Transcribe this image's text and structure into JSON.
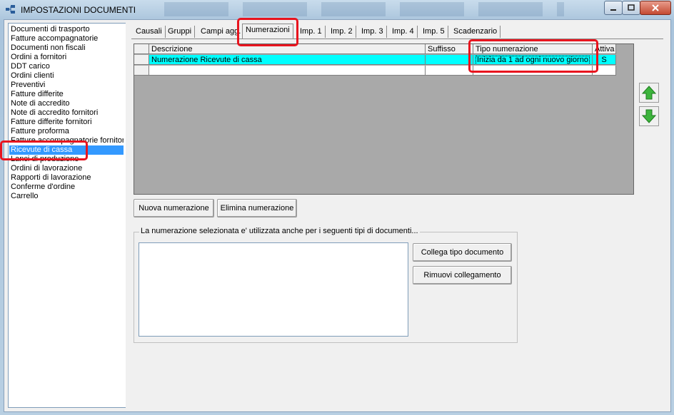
{
  "window": {
    "title": "IMPOSTAZIONI DOCUMENTI",
    "controls": {
      "minimize": "minimize-icon",
      "maximize": "maximize-icon",
      "close": "close-icon"
    }
  },
  "doc_types": [
    "Documenti di trasporto",
    "Fatture accompagnatorie",
    "Documenti non fiscali",
    "Ordini a fornitori",
    "DDT carico",
    "Ordini clienti",
    "Preventivi",
    "Fatture differite",
    "Note di accredito",
    "Note di accredito fornitori",
    "Fatture differite fornitori",
    "Fatture proforma",
    "Fatture accompagnatorie fornitori",
    "Ricevute di cassa",
    "Lanci di produzione",
    "Ordini di lavorazione",
    "Rapporti di lavorazione",
    "Conferme d'ordine",
    "Carrello"
  ],
  "selected_doc_type": "Ricevute di cassa",
  "tabs": [
    "Causali",
    "Gruppi",
    "Campi agg.",
    "Numerazioni",
    "Imp. 1",
    "Imp. 2",
    "Imp. 3",
    "Imp. 4",
    "Imp. 5",
    "Scadenzario"
  ],
  "active_tab": "Numerazioni",
  "grid": {
    "columns": [
      "Descrizione",
      "Suffisso",
      "Tipo numerazione",
      "Attiva"
    ],
    "rows": [
      {
        "descrizione": "Numerazione Ricevute di cassa",
        "suffisso": "",
        "tipo": "Inizia da 1 ad ogni nuovo giorno",
        "attiva": "S"
      }
    ]
  },
  "buttons": {
    "nuova": "Nuova numerazione",
    "elimina": "Elimina numerazione",
    "collega": "Collega tipo documento",
    "rimuovi": "Rimuovi collegamento"
  },
  "group": {
    "label": "La numerazione selezionata e' utilizzata anche per i seguenti tipi di documenti..."
  },
  "colors": {
    "selection": "#3399ff",
    "row_highlight": "#00ffff",
    "annotation": "#e8141e",
    "arrow": "#3cb43c"
  }
}
